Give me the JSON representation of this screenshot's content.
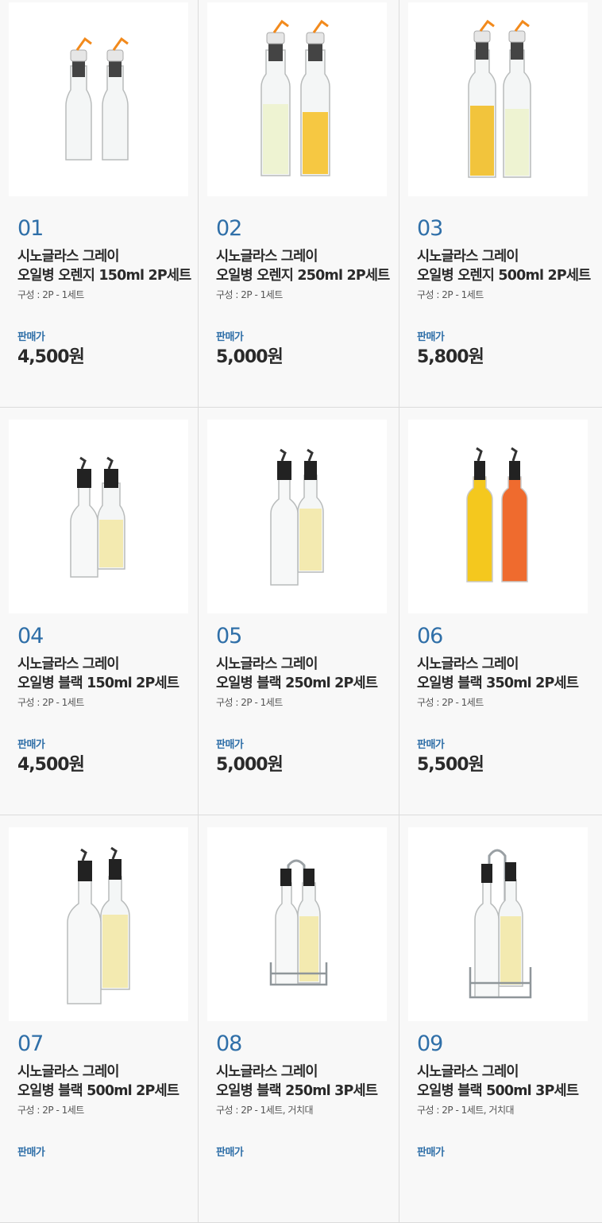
{
  "price_label": "판매가",
  "colors": {
    "accent": "#2f6fa8",
    "text": "#2a2a2a",
    "cell_bg": "#f8f8f8"
  },
  "products": [
    {
      "number": "01",
      "name_line1": "시노글라스 그레이",
      "name_line2": "오일병 오렌지 150ml 2P세트",
      "composition": "구성 : 2P - 1세트",
      "price": "4,500원",
      "image": "oil-bottles-orange-150ml-icon"
    },
    {
      "number": "02",
      "name_line1": "시노글라스 그레이",
      "name_line2": "오일병 오렌지 250ml 2P세트",
      "composition": "구성 : 2P - 1세트",
      "price": "5,000원",
      "image": "oil-bottles-orange-250ml-icon"
    },
    {
      "number": "03",
      "name_line1": "시노글라스 그레이",
      "name_line2": "오일병 오렌지 500ml 2P세트",
      "composition": "구성 : 2P - 1세트",
      "price": "5,800원",
      "image": "oil-bottles-orange-500ml-icon"
    },
    {
      "number": "04",
      "name_line1": "시노글라스 그레이",
      "name_line2": "오일병 블랙 150ml 2P세트",
      "composition": "구성 : 2P - 1세트",
      "price": "4,500원",
      "image": "oil-bottles-black-150ml-icon"
    },
    {
      "number": "05",
      "name_line1": "시노글라스 그레이",
      "name_line2": "오일병 블랙 250ml 2P세트",
      "composition": "구성 : 2P - 1세트",
      "price": "5,000원",
      "image": "oil-bottles-black-250ml-icon"
    },
    {
      "number": "06",
      "name_line1": "시노글라스 그레이",
      "name_line2": "오일병 블랙 350ml 2P세트",
      "composition": "구성 : 2P - 1세트",
      "price": "5,500원",
      "image": "oil-bottles-black-350ml-icon"
    },
    {
      "number": "07",
      "name_line1": "시노글라스 그레이",
      "name_line2": "오일병 블랙 500ml 2P세트",
      "composition": "구성 : 2P - 1세트",
      "price": "",
      "image": "oil-bottles-black-500ml-icon"
    },
    {
      "number": "08",
      "name_line1": "시노글라스 그레이",
      "name_line2": "오일병 블랙 250ml 3P세트",
      "composition": "구성 : 2P - 1세트, 거치대",
      "price": "",
      "image": "oil-bottles-rack-250ml-icon"
    },
    {
      "number": "09",
      "name_line1": "시노글라스 그레이",
      "name_line2": "오일병 블랙 500ml 3P세트",
      "composition": "구성 : 2P - 1세트, 거치대",
      "price": "",
      "image": "oil-bottles-rack-500ml-icon"
    }
  ]
}
